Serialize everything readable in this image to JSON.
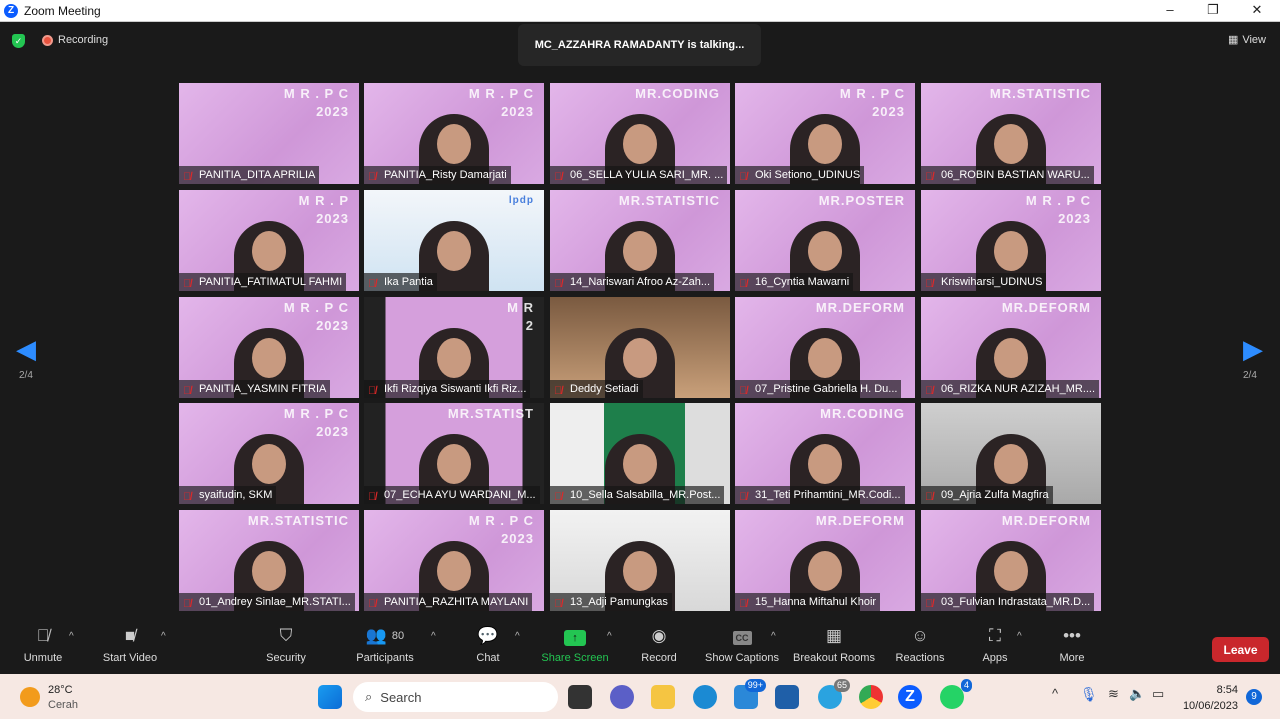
{
  "window": {
    "title": "Zoom Meeting",
    "minimize": "–",
    "maximize": "❐",
    "close": "✕"
  },
  "top": {
    "recording": "Recording",
    "talking": "MC_AZZAHRA RAMADANTY is talking...",
    "view": "View",
    "page_left": "2/4",
    "page_right": "2/4"
  },
  "tiles": [
    {
      "name": "PANITIA_DITA APRILIA",
      "overlay": "M R . P C\n2023",
      "bg": "pink",
      "person": false
    },
    {
      "name": "PANITIA_Risty Damarjati",
      "overlay": "M R . P C\n2023",
      "bg": "pink",
      "person": true
    },
    {
      "name": "06_SELLA YULIA SARI_MR. ...",
      "overlay": "MR.CODING",
      "bg": "pink",
      "person": true
    },
    {
      "name": "Oki Setiono_UDINUS",
      "overlay": "M R . P C\n2023",
      "bg": "pink",
      "person": true
    },
    {
      "name": "06_ROBIN BASTIAN WARU...",
      "overlay": "MR.STATISTIC",
      "bg": "pink",
      "person": true
    },
    {
      "name": "PANITIA_FATIMATUL FAHMI",
      "overlay": "M R . P\n2023",
      "bg": "pink",
      "person": true
    },
    {
      "name": "Ika Pantia",
      "overlay": "lpdp",
      "bg": "light",
      "person": true
    },
    {
      "name": "14_Nariswari Afroo Az-Zah...",
      "overlay": "MR.STATISTIC",
      "bg": "pink",
      "person": true
    },
    {
      "name": "16_Cyntia Mawarni",
      "overlay": "MR.POSTER",
      "bg": "pink",
      "person": true
    },
    {
      "name": "Kriswiharsi_UDINUS",
      "overlay": "M R . P C\n2023",
      "bg": "pink",
      "person": true
    },
    {
      "name": "PANITIA_YASMIN FITRIA",
      "overlay": "M R . P C\n2023",
      "bg": "pink",
      "person": true
    },
    {
      "name": "Ikfi Rizqiya Siswanti Ikfi Riz...",
      "overlay": "M R\n2",
      "bg": "darkpink",
      "person": true
    },
    {
      "name": "Deddy Setiadi",
      "overlay": "",
      "bg": "brown",
      "person": true
    },
    {
      "name": "07_Pristine Gabriella H. Du...",
      "overlay": "MR.DEFORM",
      "bg": "pink",
      "person": true
    },
    {
      "name": "06_RIZKA NUR AZIZAH_MR....",
      "overlay": "MR.DEFORM",
      "bg": "pink",
      "person": true
    },
    {
      "name": "syaifudin, SKM",
      "overlay": "M R . P C\n2023",
      "bg": "pink",
      "person": true
    },
    {
      "name": "07_ECHA AYU WARDANI_M...",
      "overlay": "MR.STATIST",
      "bg": "darkpink",
      "person": true
    },
    {
      "name": "10_Sella Salsabilla_MR.Post...",
      "overlay": "",
      "bg": "green",
      "person": true
    },
    {
      "name": "31_Teti Prihamtini_MR.Codi...",
      "overlay": "MR.CODING",
      "bg": "pink",
      "person": true
    },
    {
      "name": "09_Ajria Zulfa Magfira",
      "overlay": "",
      "bg": "grey",
      "person": true
    },
    {
      "name": "01_Andrey Sinlae_MR.STATI...",
      "overlay": "MR.STATISTIC",
      "bg": "pink",
      "person": true
    },
    {
      "name": "PANITIA_RAZHITA MAYLANI",
      "overlay": "M R . P C\n2023",
      "bg": "pink",
      "person": true
    },
    {
      "name": "13_Adji Pamungkas",
      "overlay": "",
      "bg": "white",
      "person": true
    },
    {
      "name": "15_Hanna Miftahul Khoir",
      "overlay": "MR.DEFORM",
      "bg": "pink",
      "person": true
    },
    {
      "name": "03_Fulvian Indrastata_MR.D...",
      "overlay": "MR.DEFORM",
      "bg": "pink",
      "person": true
    }
  ],
  "toolbar": {
    "unmute": "Unmute",
    "start_video": "Start Video",
    "security": "Security",
    "participants": "Participants",
    "participants_count": "80",
    "chat": "Chat",
    "share_screen": "Share Screen",
    "record": "Record",
    "captions": "Show Captions",
    "captions_icon": "CC",
    "breakout": "Breakout Rooms",
    "reactions": "Reactions",
    "apps": "Apps",
    "more": "More",
    "leave": "Leave"
  },
  "taskbar": {
    "temp": "28°C",
    "weather": "Cerah",
    "search": "Search",
    "mail_badge": "99+",
    "telegram_badge": "65",
    "whatsapp_badge": "4",
    "time": "8:54",
    "date": "10/06/2023",
    "notif": "9"
  },
  "colors": {
    "accent": "#2d8cff",
    "leave": "#c9272c",
    "share": "#23c552",
    "tile_pink": "#d9a6e0"
  }
}
